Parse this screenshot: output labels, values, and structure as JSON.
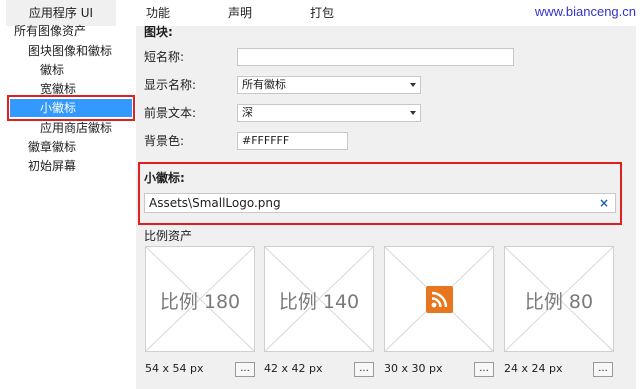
{
  "tabs": [
    {
      "label": "应用程序 UI"
    },
    {
      "label": "功能"
    },
    {
      "label": "声明"
    },
    {
      "label": "打包"
    }
  ],
  "watermark": "www.bianceng.cn",
  "tree": {
    "items": [
      {
        "label": "所有图像资产"
      },
      {
        "label": "图块图像和徽标"
      },
      {
        "label": "徽标"
      },
      {
        "label": "宽徽标"
      },
      {
        "label": "小徽标"
      },
      {
        "label": "应用商店徽标"
      },
      {
        "label": "徽章徽标"
      },
      {
        "label": "初始屏幕"
      }
    ],
    "selected": "小徽标"
  },
  "tile_section": {
    "heading": "图块:",
    "short_name": {
      "label": "短名称:",
      "value": ""
    },
    "display_name": {
      "label": "显示名称:",
      "value": "所有徽标"
    },
    "foreground_text": {
      "label": "前景文本:",
      "value": "深"
    },
    "background_color": {
      "label": "背景色:",
      "value": "#FFFFFF"
    }
  },
  "small_logo": {
    "heading": "小徽标:",
    "path": "Assets\\SmallLogo.png",
    "clear_glyph": "×"
  },
  "scale_assets": {
    "heading": "比例资产",
    "tiles": [
      {
        "label": "比例 180",
        "size": "54 x 54 px",
        "button": "..."
      },
      {
        "label": "比例 140",
        "size": "42 x 42 px",
        "button": "..."
      },
      {
        "label": "",
        "size": "30 x 30 px",
        "button": "...",
        "icon": "rss-icon"
      },
      {
        "label": "比例 80",
        "size": "24 x 24 px",
        "button": "..."
      }
    ]
  },
  "colors": {
    "accent": "#3399ff",
    "highlight_border": "#e02020",
    "rss": "#e8761e"
  }
}
